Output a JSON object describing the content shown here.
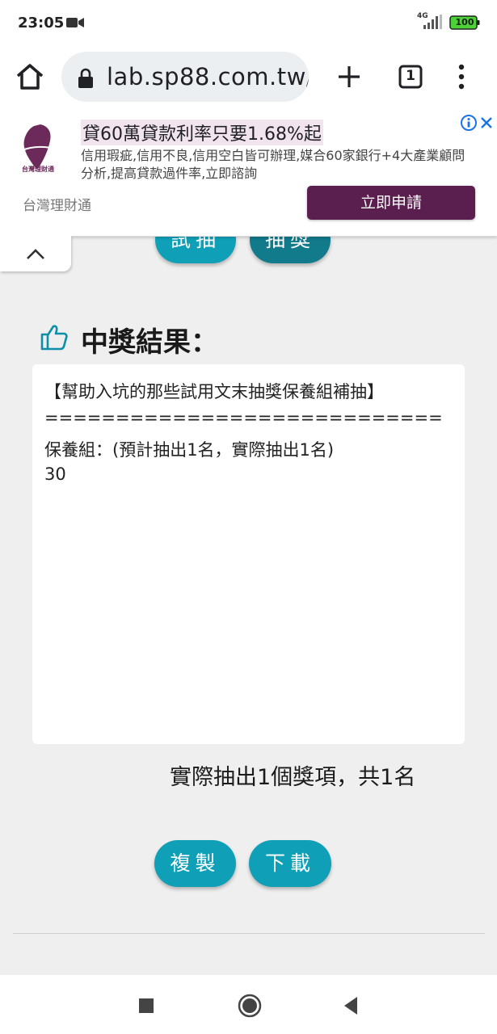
{
  "status_bar": {
    "time": "23:05",
    "network": "4G",
    "battery": "100"
  },
  "browser": {
    "url": "lab.sp88.com.tw/",
    "tab_count": "1"
  },
  "ad": {
    "title": "貸60萬貸款利率只要1.68%起",
    "description": "信用瑕疵,信用不良,信用空白皆可辦理,媒合60家銀行+4大產業顧問分析,提高貸款過件率,立即諮詢",
    "advertiser": "台灣理財通",
    "logo_text": "台灣理財通",
    "cta_label": "立即申請",
    "brand_color": "#5b1f4f"
  },
  "top_buttons": {
    "left_label": "試抽",
    "right_label": "抽獎"
  },
  "result": {
    "heading": "中獎結果：",
    "lines": [
      "【幫助入坑的那些試用文末抽獎保養組補抽】",
      "============================",
      "保養組：(預計抽出1名，實際抽出1名)",
      "30"
    ],
    "summary": "實際抽出1個獎項，共1名"
  },
  "actions": {
    "copy_label": "複製",
    "download_label": "下載"
  },
  "colors": {
    "accent": "#0fa0b8",
    "accent_dark": "#117a8b",
    "page_background": "#efefef"
  }
}
